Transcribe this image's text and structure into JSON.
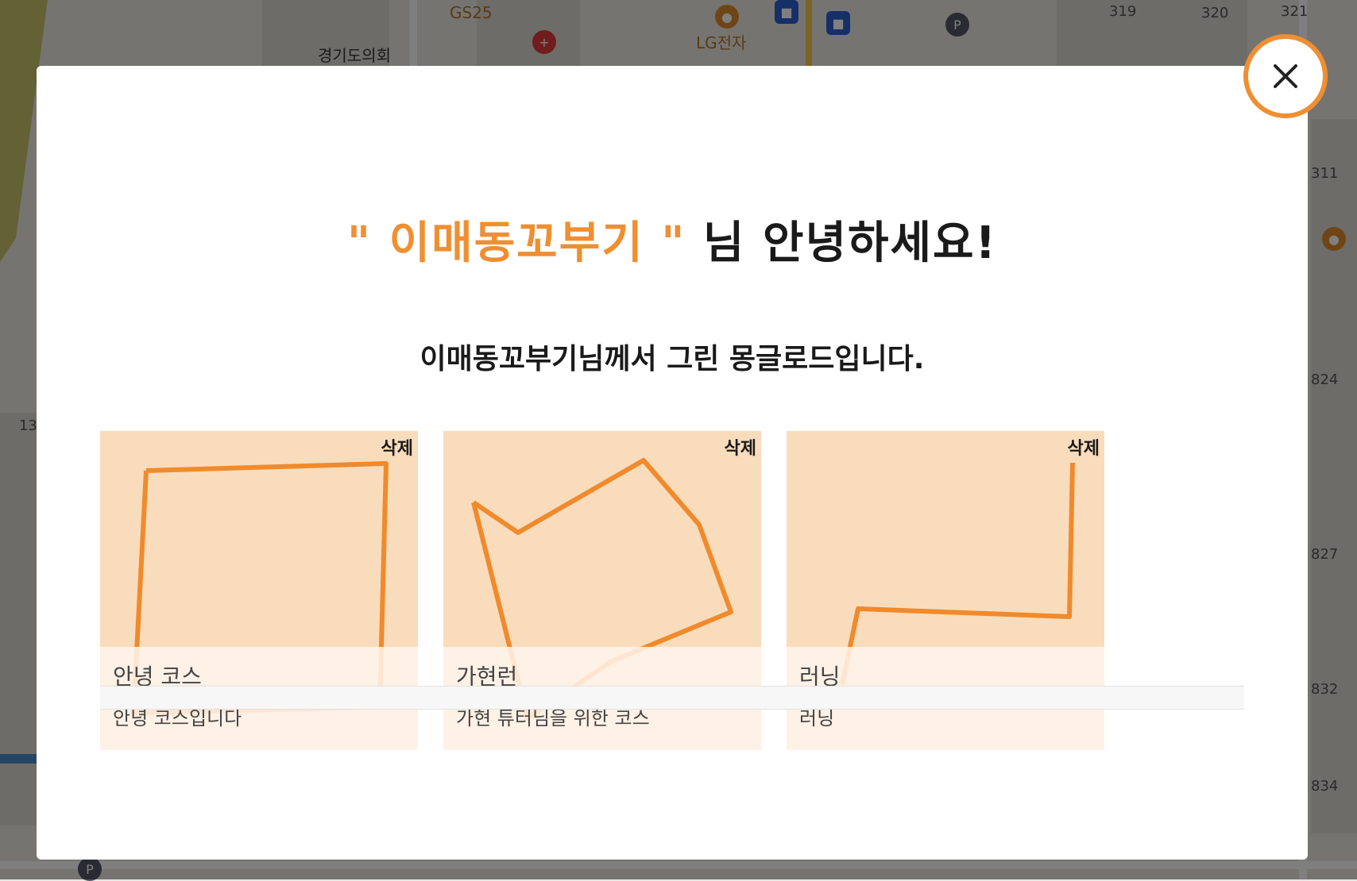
{
  "map": {
    "labels": [
      {
        "text": "GS25",
        "cls": "brown"
      },
      {
        "text": "경기도의회",
        "cls": ""
      },
      {
        "text": "LG전자",
        "cls": "brown"
      },
      {
        "text": "319",
        "cls": "small"
      },
      {
        "text": "320",
        "cls": "small"
      },
      {
        "text": "321",
        "cls": "small"
      },
      {
        "text": "311",
        "cls": "small"
      },
      {
        "text": "824",
        "cls": "small"
      },
      {
        "text": "827",
        "cls": "small"
      },
      {
        "text": "832",
        "cls": "small"
      },
      {
        "text": "834",
        "cls": "small"
      },
      {
        "text": "13",
        "cls": "small"
      }
    ],
    "colors": {
      "accent": "#ef8f32",
      "bus": "#2b5fd0",
      "hospital": "#e03a3a",
      "poi": "#e08a2a"
    }
  },
  "modal": {
    "close_icon": "close-icon",
    "greeting": {
      "open_quote": "\"",
      "nickname": "이매동꼬부기",
      "close_quote": "\"",
      "suffix": "님 안녕하세요!"
    },
    "subtitle": "이매동꼬부기님께서 그린 몽글로드입니다.",
    "delete_label": "삭제",
    "courses": [
      {
        "title": "안녕 코스",
        "description": "안녕 코스입니다"
      },
      {
        "title": "가현런",
        "description": "가현 튜터님을 위한 코스"
      },
      {
        "title": "러닝",
        "description": "러닝"
      }
    ]
  }
}
